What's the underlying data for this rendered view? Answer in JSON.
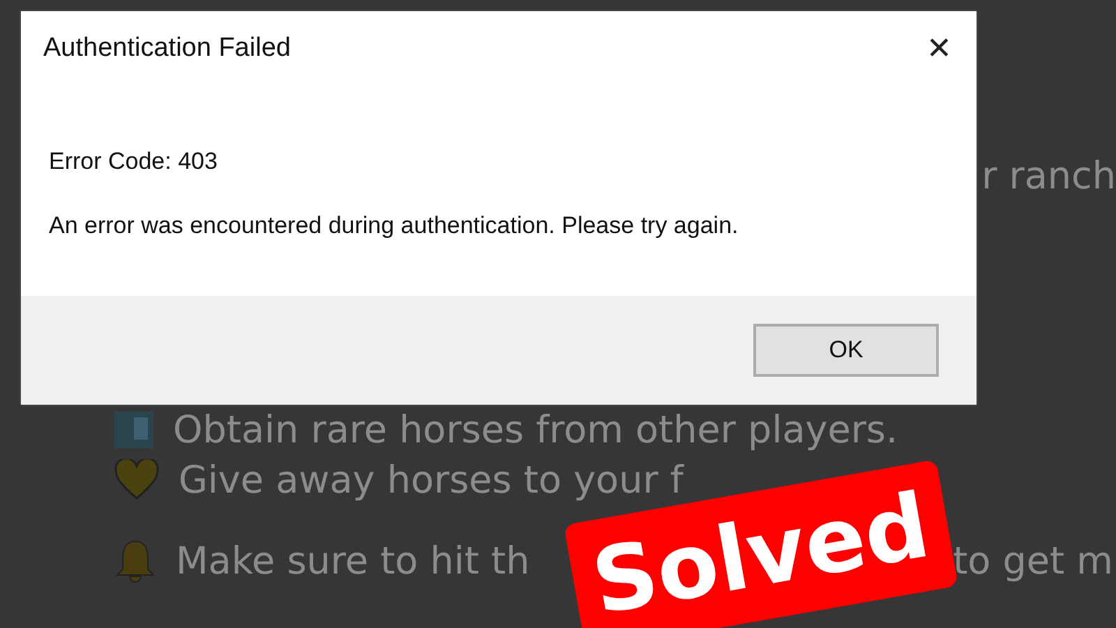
{
  "background_page": {
    "lines": [
      {
        "kind": "plain",
        "text": "r ranch"
      },
      {
        "kind": "picture-icon",
        "text": "Obtain rare horses from other players."
      },
      {
        "kind": "heart",
        "text": "Give away horses to your f"
      },
      {
        "kind": "bell",
        "text": "Make sure to hit th",
        "tail": "to get m"
      }
    ]
  },
  "dialog": {
    "title": "Authentication Failed",
    "close": "✕",
    "error_code": "Error Code: 403",
    "message": "An error was encountered during authentication. Please try again.",
    "buttons": [
      "OK"
    ]
  },
  "sticker": {
    "text": "Solved"
  }
}
